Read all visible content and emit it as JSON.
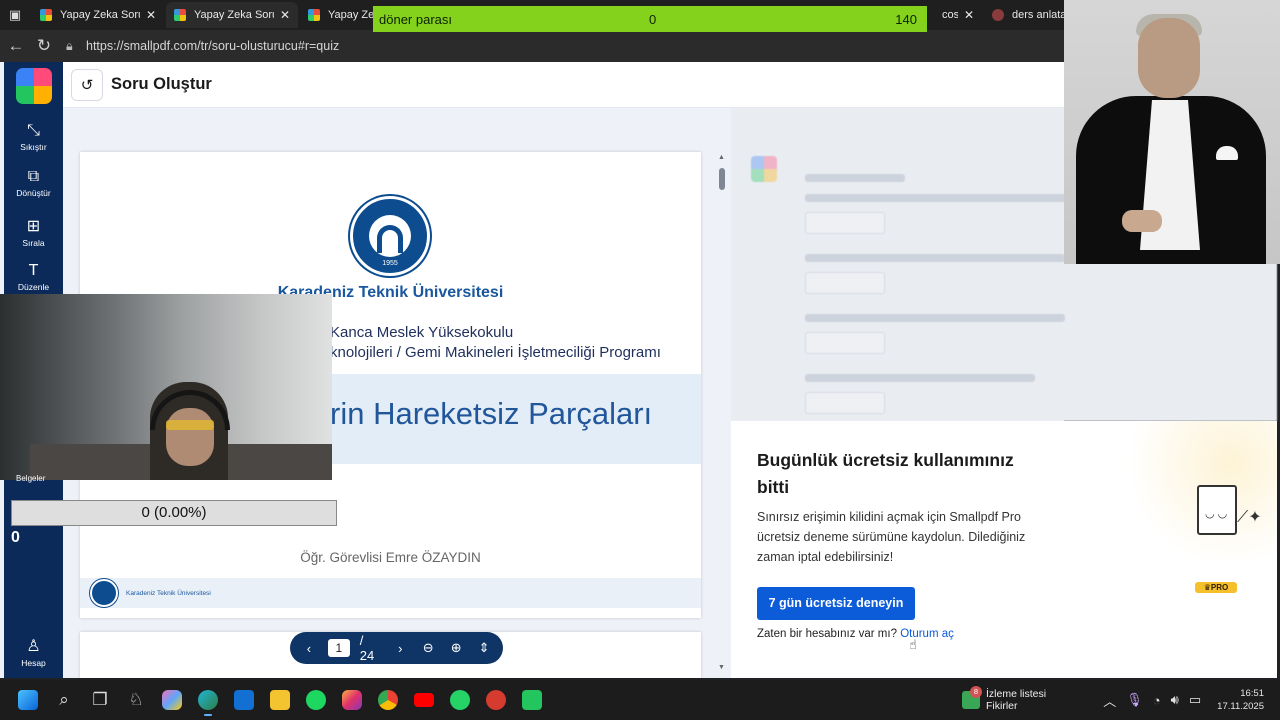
{
  "browser": {
    "tabs": [
      {
        "title": "Yapay Zeka Soru O",
        "active": false
      },
      {
        "title": "Yapay Zeka Soru O",
        "active": true
      },
      {
        "title": "Yapay Zeka",
        "active": false
      },
      {
        "title": "cosu",
        "active": false
      },
      {
        "title": "ders anlatan ai p",
        "active": false
      }
    ],
    "url": "https://smallpdf.com/tr/soru-olusturucu#r=quiz"
  },
  "counter_overlay": {
    "label": "döner parası",
    "value": "0",
    "max": "140"
  },
  "app": {
    "page_title": "Soru Oluştur",
    "rail": [
      {
        "label": "Sıkıştır",
        "icon": "compress-icon"
      },
      {
        "label": "Dönüştür",
        "icon": "convert-icon"
      },
      {
        "label": "Sırala",
        "icon": "grid-icon"
      },
      {
        "label": "Düzenle",
        "icon": "text-icon"
      },
      {
        "label": "Hesap",
        "icon": "account-icon"
      }
    ],
    "rail_partial_label": "Belgeler"
  },
  "document": {
    "seal_year": "1955",
    "university": "Karadeniz Teknik Üniversitesi",
    "school": "Kanca Meslek Yüksekokulu",
    "program": "knolojileri / Gemi Makineleri İşletmeciliği Programı",
    "topic": "rin Hareketsiz Parçaları",
    "author": "Öğr. Görevlisi Emre ÖZAYDIN",
    "footer": "Karadeniz Teknik Üniversitesi"
  },
  "pager": {
    "current": "1",
    "total": "/ 24"
  },
  "upsell": {
    "title": "Bugünlük ücretsiz kullanımınız bitti",
    "body": "Sınırsız erişimin kilidini açmak için Smallpdf Pro ücretsiz deneme sürümüne kaydolun. Dilediğiniz zaman iptal edebilirsiniz!",
    "cta": "7 gün ücretsiz deneyin",
    "login_prompt": "Zaten bir hesabınız var mı?",
    "login_link": "Oturum aç",
    "badge": "PRO"
  },
  "stream_overlay": {
    "progress_text": "0 (0.00%)",
    "count": "0"
  },
  "taskbar": {
    "widget_title": "İzleme listesi",
    "widget_sub": "Fikirler",
    "widget_badge": "8",
    "time": "16:51",
    "date": "17.11.2025"
  },
  "colors": {
    "brand_blue": "#0c5bd8",
    "rail": "#0b2a5a",
    "counter_green": "#84d21c",
    "uni_blue": "#19579e"
  }
}
